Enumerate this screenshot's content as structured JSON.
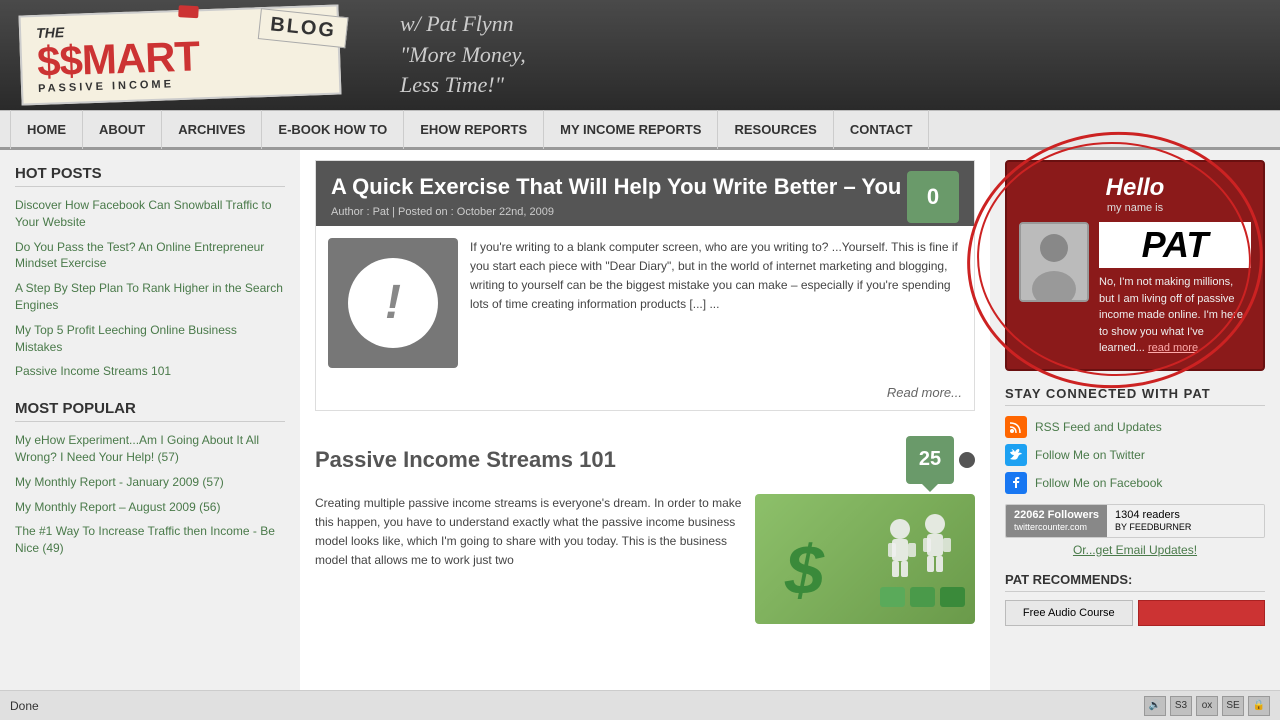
{
  "header": {
    "logo_the": "THE",
    "logo_smart": "$MART",
    "logo_sub": "PASSIVE INCOME",
    "logo_blog": "BLOG",
    "tagline_line1": "w/ Pat Flynn",
    "tagline_line2": "\"More Money,",
    "tagline_line3": "Less Time!\""
  },
  "nav": {
    "items": [
      {
        "label": "HOME",
        "id": "home"
      },
      {
        "label": "ABOUT",
        "id": "about"
      },
      {
        "label": "ARCHIVES",
        "id": "archives"
      },
      {
        "label": "E-BOOK HOW TO",
        "id": "ebook"
      },
      {
        "label": "EHOW REPORTS",
        "id": "ehow"
      },
      {
        "label": "MY INCOME REPORTS",
        "id": "income"
      },
      {
        "label": "RESOURCES",
        "id": "resources"
      },
      {
        "label": "CONTACT",
        "id": "contact"
      }
    ]
  },
  "sidebar": {
    "hot_posts_title": "HOT POSTS",
    "hot_posts": [
      "Discover How Facebook Can Snowball Traffic to Your Website",
      "Do You Pass the Test? An Online Entrepreneur Mindset Exercise",
      "A Step By Step Plan To Rank Higher in the Search Engines",
      "My Top 5 Profit Leeching Online Business Mistakes",
      "Passive Income Streams 101"
    ],
    "most_popular_title": "MOST POPULAR",
    "most_popular": [
      "My eHow Experiment...Am I Going About It All Wrong? I Need Your Help! (57)",
      "My Monthly Report - January 2009 (57)",
      "My Monthly Report – August 2009 (56)",
      "The #1 Way To Increase Traffic then Income - Be Nice (49)"
    ]
  },
  "article1": {
    "title": "A Quick Exercise That Will Help You Write Better – You Try!",
    "meta": "Author : Pat | Posted on : October 22nd, 2009",
    "comment_count": "0",
    "thumb_symbol": "!",
    "body": "If you're writing to a blank computer screen, who are you writing to? ...Yourself. This is fine if you start each piece with \"Dear Diary\", but in the world of internet marketing and blogging, writing to yourself can be the biggest mistake you can make – especially if you're spending lots of time creating information products [...] ...",
    "read_more": "Read more..."
  },
  "article2": {
    "title": "Passive Income Streams 101",
    "comment_count": "25",
    "body": "Creating multiple passive income streams is everyone's dream. In order to make this happen, you have to understand exactly what the passive income business model looks like, which I'm going to share with you today. This is the business model that allows me to work just two"
  },
  "right_sidebar": {
    "hello_title": "Hello",
    "hello_sub": "my name is",
    "pat_name": "PAT",
    "pat_bio": "No, I'm not making millions, but I am living off of passive income made online. I'm here to show you what I've learned...",
    "read_more": "read more",
    "stay_title": "STAY CONNECTED WITH PAT",
    "social": [
      {
        "label": "RSS Feed and Updates",
        "type": "rss"
      },
      {
        "label": "Follow Me on Twitter",
        "type": "twitter"
      },
      {
        "label": "Follow Me on Facebook",
        "type": "facebook"
      }
    ],
    "followers_count": "22062",
    "followers_label": "Followers",
    "followers_site": "twittercounter.com",
    "readers_count": "1304 readers",
    "readers_label": "BY FEEDBURNER",
    "email_updates": "Or...get Email Updates!",
    "recommends_title": "PAT RECOMMENDS:",
    "recommend_btn1": "Free Audio Course",
    "recommend_btn2": ""
  },
  "footer": {
    "status": "Done"
  }
}
